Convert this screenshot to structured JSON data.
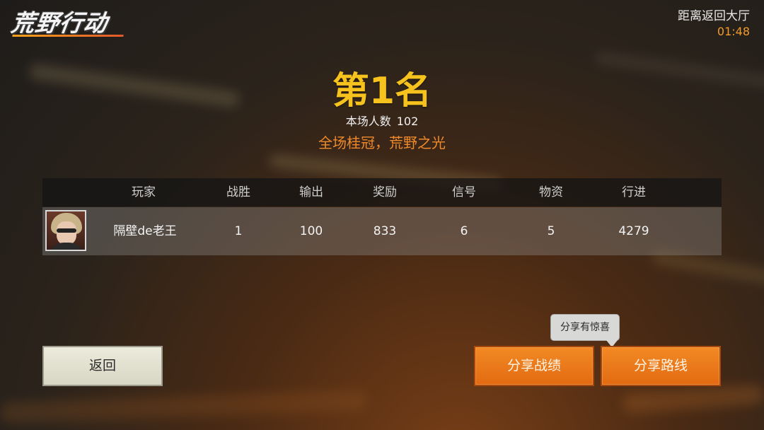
{
  "game_logo": "荒野行动",
  "countdown": {
    "label": "距离返回大厅",
    "time": "01:48"
  },
  "result": {
    "rank": "第1名",
    "player_count_label": "本场人数",
    "player_count": "102",
    "slogan": "全场桂冠，荒野之光"
  },
  "table": {
    "headers": {
      "player": "玩家",
      "wins": "战胜",
      "damage": "输出",
      "reward": "奖励",
      "signal": "信号",
      "supplies": "物资",
      "travel": "行进"
    },
    "rows": [
      {
        "player": "隔壁de老王",
        "wins": "1",
        "damage": "100",
        "reward": "833",
        "signal": "6",
        "supplies": "5",
        "travel": "4279"
      }
    ]
  },
  "buttons": {
    "back": "返回",
    "share_record": "分享战绩",
    "share_route": "分享路线"
  },
  "tooltip": "分享有惊喜",
  "colors": {
    "rank_gold": "#f6c21e",
    "slogan_orange": "#f08a2a",
    "button_orange": "#e87a1c",
    "countdown_orange": "#f29a2c"
  }
}
